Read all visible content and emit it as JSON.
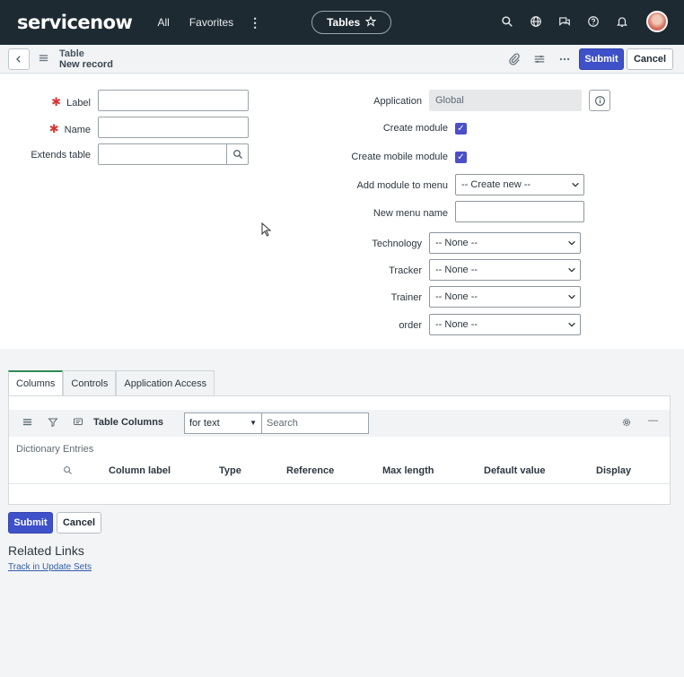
{
  "topbar": {
    "logo": "servicenow",
    "nav_all": "All",
    "nav_favorites": "Favorites",
    "nav_more": "⋮",
    "tables_pill": "Tables",
    "icons": [
      "search-icon",
      "globe-icon",
      "chat-icon",
      "help-icon",
      "bell-icon",
      "avatar"
    ]
  },
  "header": {
    "title_line1": "Table",
    "title_line2": "New record",
    "submit": "Submit",
    "cancel": "Cancel"
  },
  "form": {
    "label": {
      "label": "Label",
      "value": ""
    },
    "name": {
      "label": "Name",
      "value": ""
    },
    "extends_table": {
      "label": "Extends table",
      "value": ""
    },
    "application": {
      "label": "Application",
      "value": "Global"
    },
    "create_module": {
      "label": "Create module",
      "checked": true
    },
    "create_mobile_module": {
      "label": "Create mobile module",
      "checked": true
    },
    "add_module_to_menu": {
      "label": "Add module to menu",
      "value": "-- Create new --"
    },
    "new_menu_name": {
      "label": "New menu name",
      "value": ""
    },
    "technology": {
      "label": "Technology",
      "value": "-- None --"
    },
    "tracker": {
      "label": "Tracker",
      "value": "-- None --"
    },
    "trainer": {
      "label": "Trainer",
      "value": "-- None --"
    },
    "order": {
      "label": "order",
      "value": "-- None --"
    }
  },
  "tabs": [
    "Columns",
    "Controls",
    "Application Access"
  ],
  "related_list": {
    "title": "Table Columns",
    "search_field": "for text",
    "search_placeholder": "Search",
    "breadcrumb": "Dictionary Entries",
    "columns": [
      "Column label",
      "Type",
      "Reference",
      "Max length",
      "Default value",
      "Display"
    ]
  },
  "footer": {
    "submit": "Submit",
    "cancel": "Cancel",
    "related_links_title": "Related Links",
    "track_link": "Track in Update Sets"
  },
  "colors": {
    "topbar": "#1e2a32",
    "primary": "#3e51c9",
    "required": "#d93434",
    "active_tab": "#2e8b57"
  }
}
